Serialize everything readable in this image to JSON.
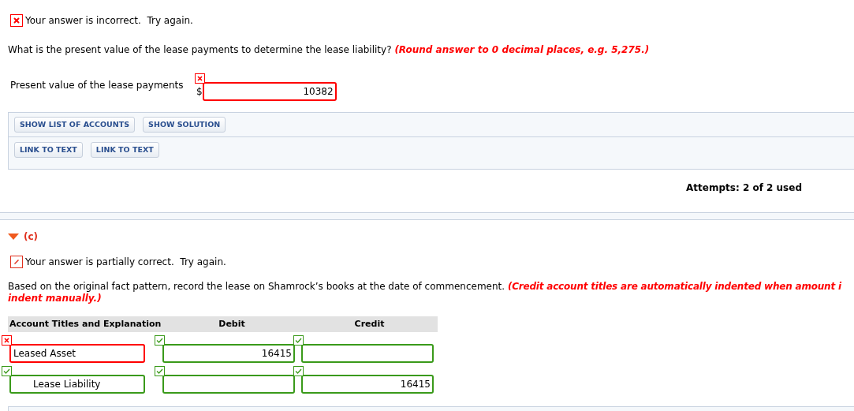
{
  "part_b": {
    "feedback": {
      "kind": "incorrect",
      "text": "Your answer is incorrect.  Try again."
    },
    "question": {
      "text": "What is the present value of the lease payments to determine the lease liability?",
      "hint": "(Round answer to 0 decimal places, e.g. 5,275.)"
    },
    "answer": {
      "label": "Present value of the lease payments",
      "currency": "$",
      "value": "10382",
      "correct": false
    },
    "button_rows": [
      [
        "SHOW LIST OF ACCOUNTS",
        "SHOW SOLUTION"
      ],
      [
        "LINK TO TEXT",
        "LINK TO TEXT"
      ]
    ],
    "attempts": "Attempts: 2 of 2 used"
  },
  "part_c": {
    "header": {
      "label": "(c)",
      "expanded": true
    },
    "feedback": {
      "kind": "partial",
      "text": "Your answer is partially correct.  Try again."
    },
    "question": {
      "text": "Based on the original fact pattern, record the lease on Shamrock’s books at the date of commencement.",
      "hint_lines": [
        "(Credit account titles are automatically indented when amount i",
        "indent manually.)"
      ]
    },
    "table": {
      "columns": [
        "Account Titles and Explanation",
        "Debit",
        "Credit"
      ],
      "rows": [
        {
          "account": {
            "value": "Leased Asset",
            "correct": false,
            "indented": false
          },
          "debit": {
            "value": "16415",
            "correct": true
          },
          "credit": {
            "correct": true
          }
        },
        {
          "account": {
            "value": "Lease Liability",
            "correct": true,
            "indented": true
          },
          "debit": {
            "correct": true
          },
          "credit": {
            "value": "16415",
            "correct": true
          }
        }
      ]
    }
  }
}
